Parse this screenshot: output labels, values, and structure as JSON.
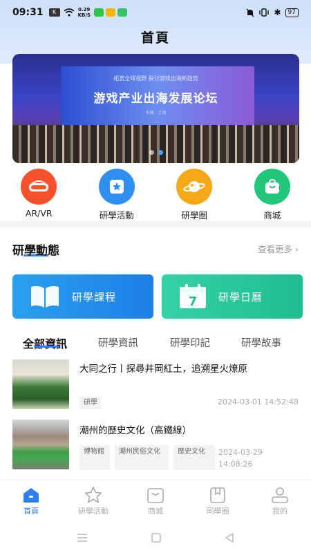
{
  "status": {
    "time": "09:31",
    "net_speed": "0.29",
    "net_unit": "KB/S",
    "battery": "97"
  },
  "header": {
    "title": "首頁"
  },
  "banner": {
    "subtitle": "拓宽全球视野  探讨游戏出海新趋势",
    "title": "游戏产业出海发展论坛",
    "tagline": "中国 · 上海",
    "dots": 2,
    "active_dot": 2
  },
  "quick_links": [
    {
      "label": "AR/VR",
      "icon": "vr-goggles-icon",
      "color": "#f4512c"
    },
    {
      "label": "研學活動",
      "icon": "star-bookmark-icon",
      "color": "#2e8ff0"
    },
    {
      "label": "研學圈",
      "icon": "planet-icon",
      "color": "#f7a818"
    },
    {
      "label": "商城",
      "icon": "shopping-bag-icon",
      "color": "#22c77a"
    }
  ],
  "section": {
    "title": "研學動態",
    "more": "查看更多"
  },
  "big_buttons": [
    {
      "label": "研學課程",
      "icon": "book-icon"
    },
    {
      "label": "研學日曆",
      "icon": "calendar-icon",
      "day": "7"
    }
  ],
  "tabs": [
    "全部資訊",
    "研學資訊",
    "研學印記",
    "研學故事"
  ],
  "articles": [
    {
      "title": "大同之行丨探尋井岡紅土，追溯星火燎原",
      "tags": [
        "研學"
      ],
      "date": "2024-03-01 14:52:48"
    },
    {
      "title": "潮州的歷史文化（高鐵線）",
      "tags": [
        "博物館",
        "潮州民俗文化",
        "歷史文化"
      ],
      "date": "2024-03-29 14:08:26"
    }
  ],
  "bottom_nav": [
    {
      "label": "首頁",
      "icon": "home-icon",
      "active": true
    },
    {
      "label": "研學活動",
      "icon": "star-icon",
      "active": false
    },
    {
      "label": "商城",
      "icon": "bag-icon",
      "active": false
    },
    {
      "label": "同學圈",
      "icon": "bookmark-icon",
      "active": false
    },
    {
      "label": "我的",
      "icon": "user-icon",
      "active": false
    }
  ],
  "colors": {
    "accent": "#2f7ff0",
    "green": "#22c77a"
  }
}
